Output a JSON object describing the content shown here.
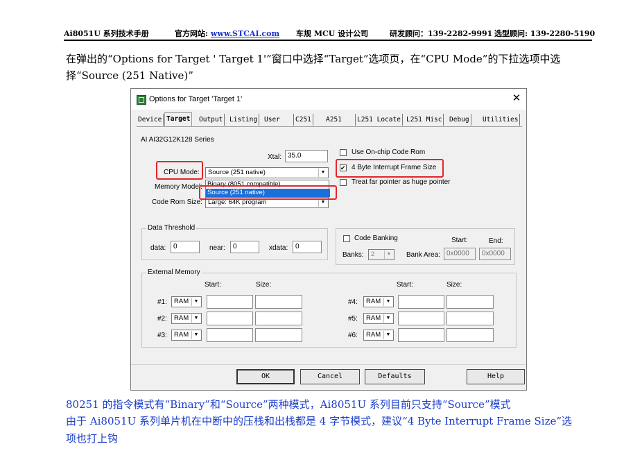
{
  "header": {
    "doc_title": "Ai8051U 系列技术手册",
    "site_label": "官方网站:",
    "site_link": "www.STCAI.com",
    "company": "车规 MCU 设计公司",
    "rnd_contact": "研发顾问：139-2282-9991",
    "sel_contact": "选型顾问: 139-2280-5190"
  },
  "intro": "在弹出的“Options for Target ' Target 1'”窗口中选择“Target”选项页，在“CPU Mode”的下拉选项中选择“Source (251 Native)”",
  "dialog": {
    "title": "Options for Target 'Target 1'",
    "close": "✕",
    "tabs": [
      "Device",
      "Target",
      "Output",
      "Listing",
      "User",
      "C251",
      "A251",
      "L251 Locate",
      "L251 Misc",
      "Debug",
      "Utilities"
    ],
    "active_tab": "Target",
    "series": "AI AI32G12K128 Series",
    "xtal_label": "Xtal:",
    "xtal_value": "35.0",
    "cpu_mode_label": "CPU Mode:",
    "cpu_mode_value": "Source (251 native)",
    "memory_model_label": "Memory Model:",
    "code_rom_label": "Code Rom Size:",
    "code_rom_value": "Large: 64K program",
    "dropdown_options": [
      "Binary (8051 compatible)",
      "Source (251 native)"
    ],
    "dropdown_selected": "Source (251 native)",
    "checkboxes": {
      "onchip": {
        "label": "Use On-chip Code Rom",
        "checked": false
      },
      "frame4": {
        "label": "4 Byte Interrupt Frame Size",
        "checked": true
      },
      "farptr": {
        "label": "Treat far pointer as huge pointer",
        "checked": false
      }
    },
    "data_threshold": {
      "title": "Data Threshold",
      "data_label": "data:",
      "data_value": "0",
      "near_label": "near:",
      "near_value": "0",
      "xdata_label": "xdata:",
      "xdata_value": "0"
    },
    "code_banking": {
      "label": "Code Banking",
      "checked": false,
      "start_label": "Start:",
      "end_label": "End:",
      "banks_label": "Banks:",
      "banks_value": "2",
      "bank_area_label": "Bank Area:",
      "start_value": "0x0000",
      "end_value": "0x0000"
    },
    "external_memory": {
      "title": "External Memory",
      "start_label": "Start:",
      "size_label": "Size:",
      "rows_left": [
        {
          "label": "#1:",
          "type": "RAM"
        },
        {
          "label": "#2:",
          "type": "RAM"
        },
        {
          "label": "#3:",
          "type": "RAM"
        }
      ],
      "rows_right": [
        {
          "label": "#4:",
          "type": "RAM"
        },
        {
          "label": "#5:",
          "type": "RAM"
        },
        {
          "label": "#6:",
          "type": "RAM"
        }
      ]
    },
    "buttons": {
      "ok": "OK",
      "cancel": "Cancel",
      "defaults": "Defaults",
      "help": "Help"
    }
  },
  "notes": [
    "80251 的指令模式有“Binary”和“Source”两种模式，Ai8051U 系列目前只支持“Source”模式",
    "由于 Ai8051U 系列单片机在中断中的压栈和出栈都是 4 字节模式，建议“4 Byte Interrupt Frame Size”选",
    "项也打上钩"
  ],
  "colors": {
    "highlight": "#e3262b",
    "note_text": "#1a3ccc",
    "selection": "#1a6fd8",
    "icon": "#2f7d3a"
  }
}
